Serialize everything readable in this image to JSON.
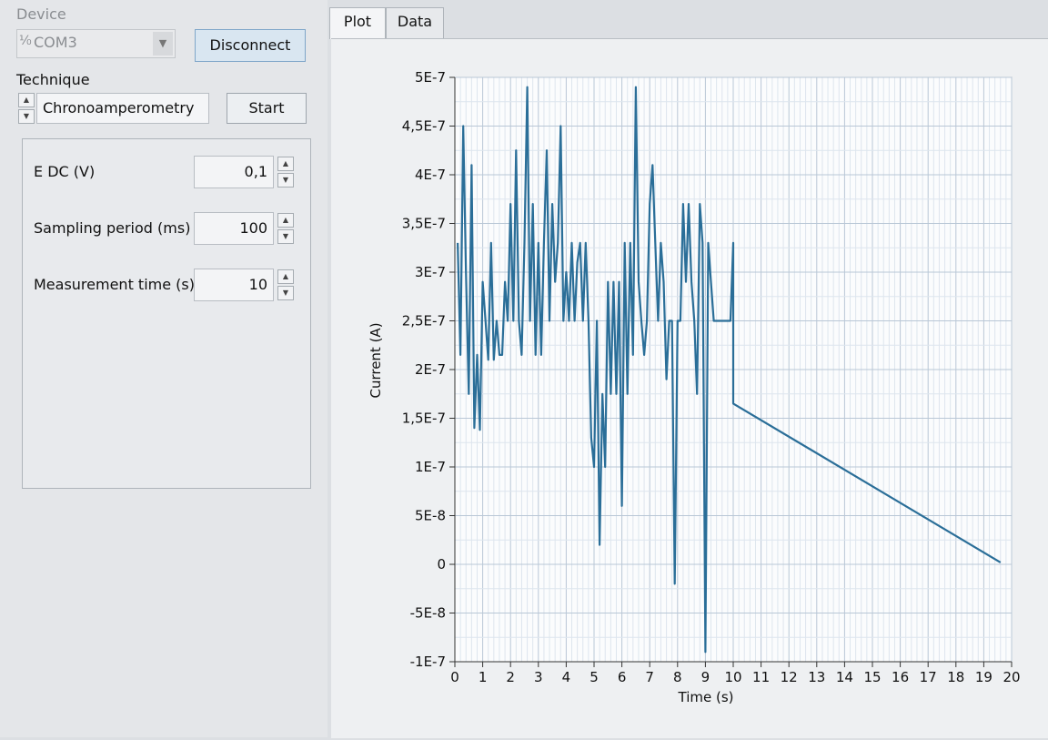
{
  "device": {
    "label": "Device",
    "port": "COM3",
    "port_icon": "usb-icon",
    "disconnect_label": "Disconnect"
  },
  "technique": {
    "label": "Technique",
    "value": "Chronoamperometry",
    "start_label": "Start"
  },
  "params": [
    {
      "label": "E DC (V)",
      "value": "0,1"
    },
    {
      "label": "Sampling period (ms)",
      "value": "100"
    },
    {
      "label": "Measurement time (s)",
      "value": "10"
    }
  ],
  "tabs": {
    "plot": "Plot",
    "data": "Data"
  },
  "chart_data": {
    "type": "line",
    "xlabel": "Time (s)",
    "ylabel": "Current (A)",
    "xlim": [
      0,
      20
    ],
    "ylim": [
      -1e-07,
      5e-07
    ],
    "x_ticks": [
      "0",
      "1",
      "2",
      "3",
      "4",
      "5",
      "6",
      "7",
      "8",
      "9",
      "10",
      "11",
      "12",
      "13",
      "14",
      "15",
      "16",
      "17",
      "18",
      "19",
      "20"
    ],
    "y_ticks": [
      {
        "value": 5e-07,
        "label": "5E-7"
      },
      {
        "value": 4.5e-07,
        "label": "4,5E-7"
      },
      {
        "value": 4e-07,
        "label": "4E-7"
      },
      {
        "value": 3.5e-07,
        "label": "3,5E-7"
      },
      {
        "value": 3e-07,
        "label": "3E-7"
      },
      {
        "value": 2.5e-07,
        "label": "2,5E-7"
      },
      {
        "value": 2e-07,
        "label": "2E-7"
      },
      {
        "value": 1.5e-07,
        "label": "1,5E-7"
      },
      {
        "value": 1e-07,
        "label": "1E-7"
      },
      {
        "value": 5e-08,
        "label": "5E-8"
      },
      {
        "value": 0,
        "label": "0"
      },
      {
        "value": -5e-08,
        "label": "-5E-8"
      },
      {
        "value": -1e-07,
        "label": "-1E-7"
      }
    ],
    "grid": true,
    "line_color": "#2a6e98",
    "series": [
      {
        "x": [
          0.1,
          0.2,
          0.3,
          0.4,
          0.5,
          0.6,
          0.7,
          0.8,
          0.9,
          1.0,
          1.1,
          1.2,
          1.3,
          1.4,
          1.5,
          1.6,
          1.7,
          1.8,
          1.9,
          2.0,
          2.1,
          2.2,
          2.3,
          2.4,
          2.5,
          2.6,
          2.7,
          2.8,
          2.9,
          3.0,
          3.1,
          3.2,
          3.3,
          3.4,
          3.5,
          3.6,
          3.7,
          3.8,
          3.9,
          4.0,
          4.1,
          4.2,
          4.3,
          4.4,
          4.5,
          4.6,
          4.7,
          4.8,
          4.9,
          5.0,
          5.1,
          5.2,
          5.3,
          5.4,
          5.5,
          5.6,
          5.7,
          5.8,
          5.9,
          6.0,
          6.1,
          6.2,
          6.3,
          6.4,
          6.5,
          6.6,
          6.7,
          6.8,
          6.9,
          7.0,
          7.1,
          7.2,
          7.3,
          7.4,
          7.5,
          7.6,
          7.7,
          7.8,
          7.9,
          8.0,
          8.1,
          8.2,
          8.3,
          8.4,
          8.5,
          8.6,
          8.7,
          8.8,
          8.9,
          9.0,
          9.1,
          9.2,
          9.3,
          9.4,
          9.5,
          9.6,
          9.7,
          9.8,
          9.9,
          10.0,
          10.0,
          19.6
        ],
        "y": [
          3.3e-07,
          2.15e-07,
          4.5e-07,
          3e-07,
          1.75e-07,
          4.1e-07,
          1.4e-07,
          2.15e-07,
          1.38e-07,
          2.9e-07,
          2.5e-07,
          2.1e-07,
          3.3e-07,
          2.1e-07,
          2.5e-07,
          2.15e-07,
          2.15e-07,
          2.9e-07,
          2.5e-07,
          3.7e-07,
          2.5e-07,
          4.25e-07,
          2.5e-07,
          2.15e-07,
          3.3e-07,
          4.9e-07,
          2.5e-07,
          3.7e-07,
          2.15e-07,
          3.3e-07,
          2.15e-07,
          3.3e-07,
          4.25e-07,
          2.5e-07,
          3.7e-07,
          2.9e-07,
          3.3e-07,
          4.5e-07,
          2.5e-07,
          3e-07,
          2.5e-07,
          3.3e-07,
          2.5e-07,
          3.1e-07,
          3.3e-07,
          2.5e-07,
          3.3e-07,
          2.5e-07,
          1.3e-07,
          1e-07,
          2.5e-07,
          2e-08,
          1.75e-07,
          1e-07,
          2.9e-07,
          1.75e-07,
          2.9e-07,
          1.75e-07,
          2.9e-07,
          6e-08,
          3.3e-07,
          1.75e-07,
          3.3e-07,
          2.15e-07,
          4.9e-07,
          2.9e-07,
          2.5e-07,
          2.15e-07,
          2.5e-07,
          3.7e-07,
          4.1e-07,
          3.3e-07,
          2.5e-07,
          3.3e-07,
          2.9e-07,
          1.9e-07,
          2.5e-07,
          2.5e-07,
          -2e-08,
          2.5e-07,
          2.5e-07,
          3.7e-07,
          2.9e-07,
          3.7e-07,
          2.9e-07,
          2.5e-07,
          1.75e-07,
          3.7e-07,
          3.3e-07,
          -9e-08,
          3.3e-07,
          2.9e-07,
          2.5e-07,
          2.5e-07,
          2.5e-07,
          2.5e-07,
          2.5e-07,
          2.5e-07,
          2.5e-07,
          3.3e-07,
          1.65e-07,
          2e-09
        ]
      }
    ]
  }
}
